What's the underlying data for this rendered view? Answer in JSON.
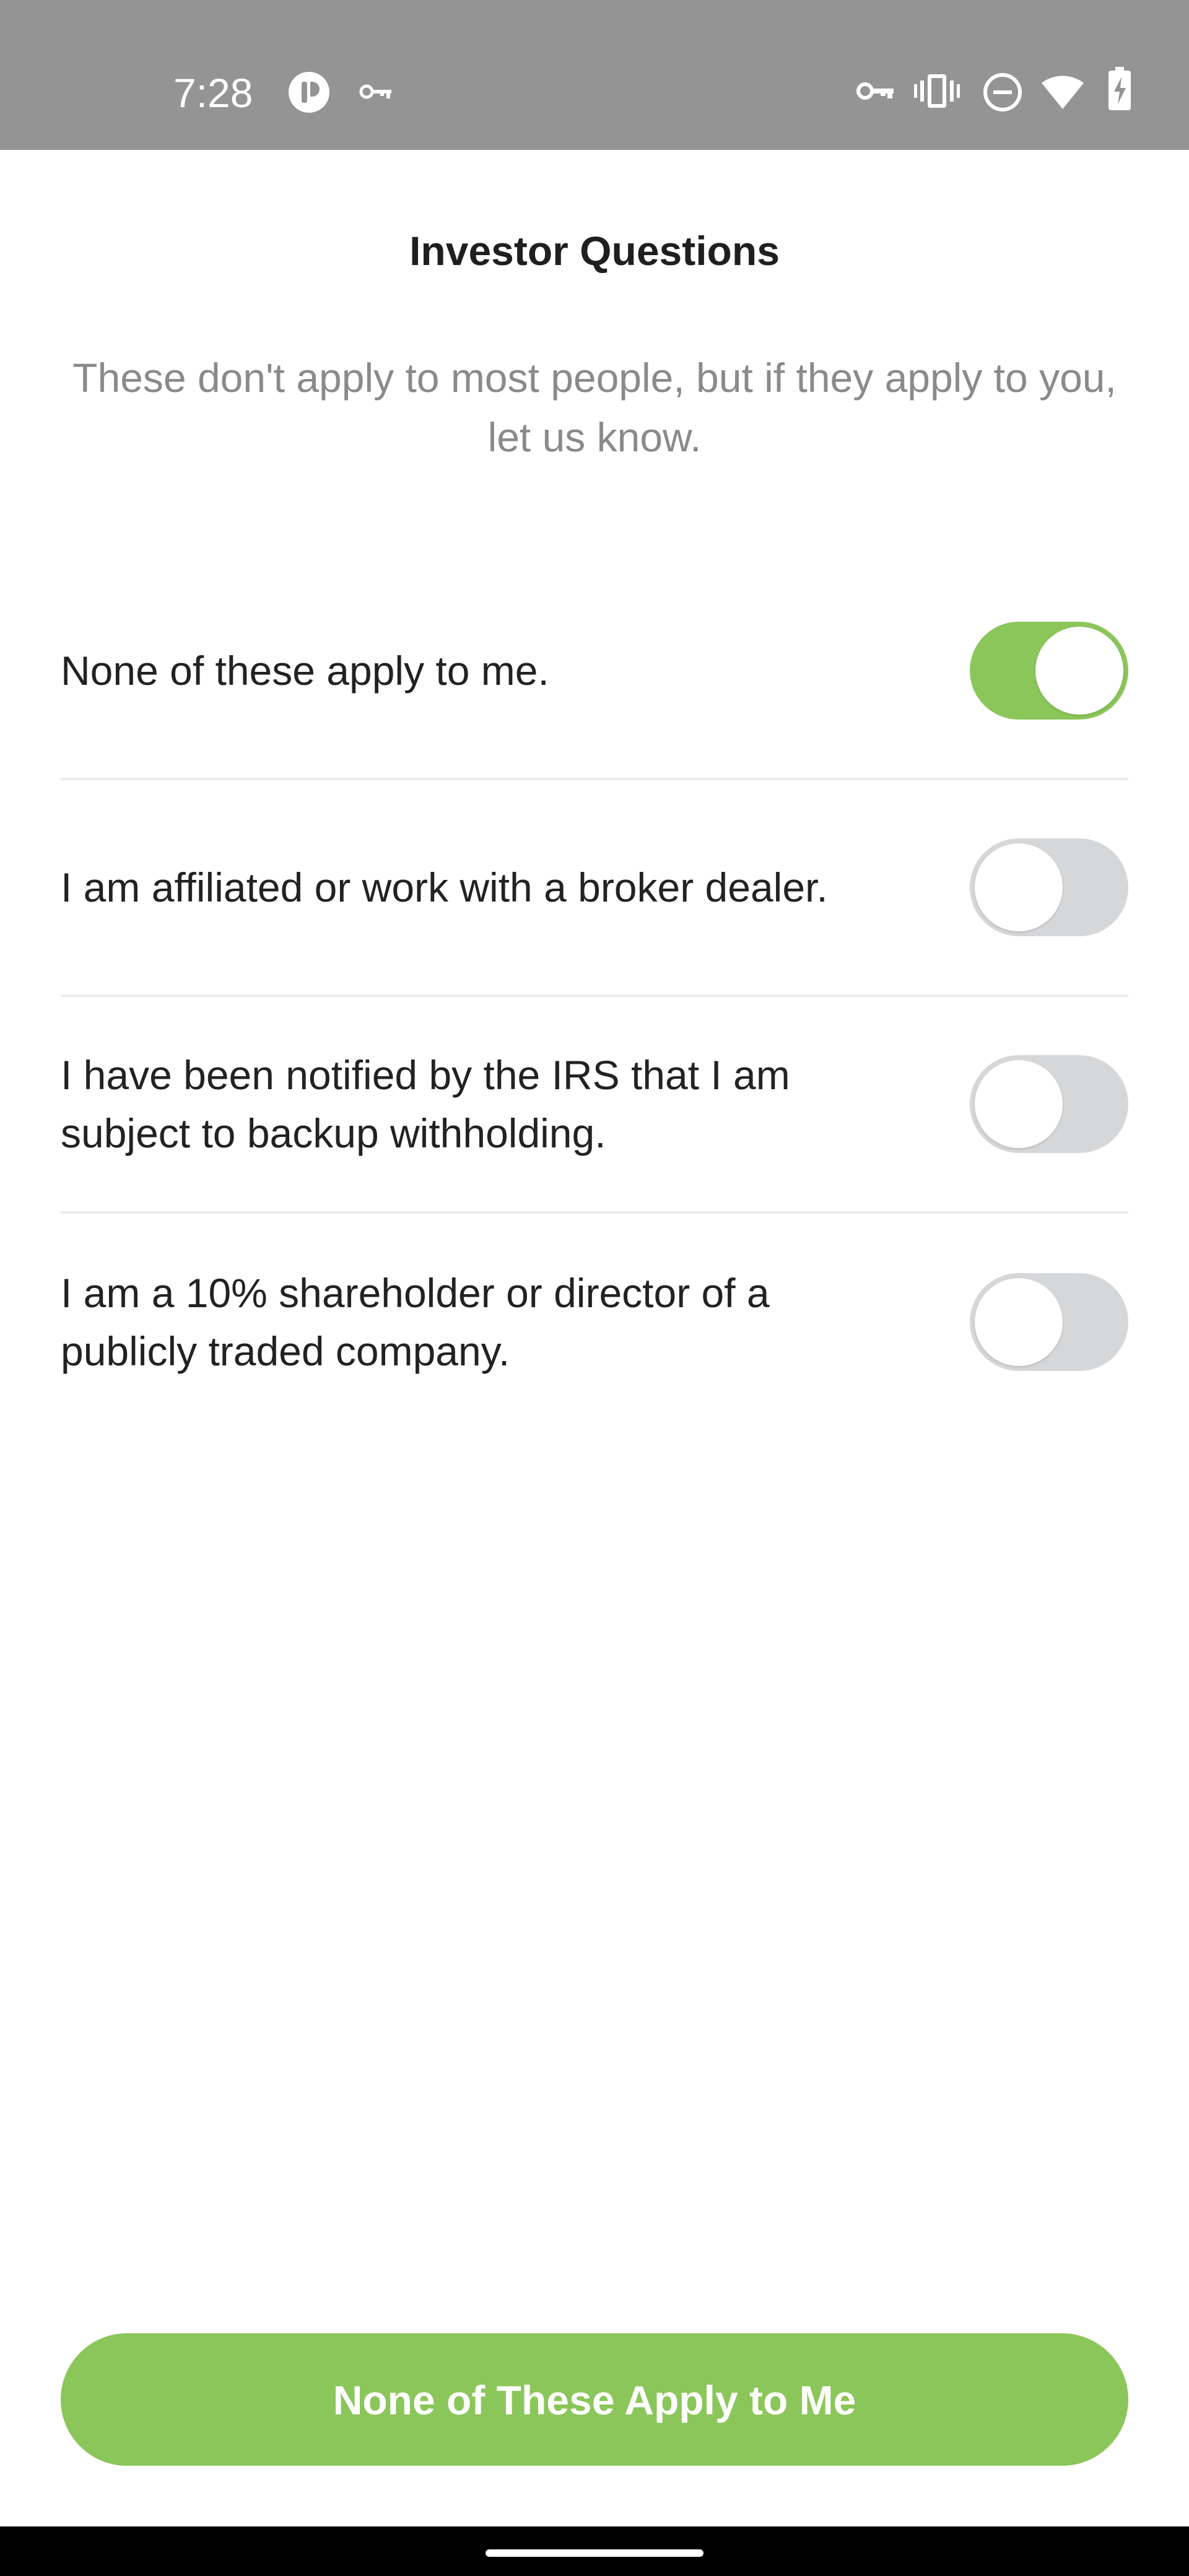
{
  "status_bar": {
    "time": "7:28",
    "left_icons": [
      "app-notification-icon",
      "vpn-key-icon"
    ],
    "right_icons": [
      "vpn-key-icon",
      "vibrate-icon",
      "do-not-disturb-icon",
      "wifi-icon",
      "battery-charging-icon"
    ]
  },
  "header": {
    "title": "Investor Questions",
    "subtitle": "These don't apply to most people, but if they apply to you, let us know."
  },
  "questions": [
    {
      "label": "None of these apply to me.",
      "enabled": true
    },
    {
      "label": "I am affiliated or work with a broker dealer.",
      "enabled": false
    },
    {
      "label": "I have been notified by the IRS that I am subject to backup withholding.",
      "enabled": false
    },
    {
      "label": "I am a 10% shareholder or director of a publicly traded company.",
      "enabled": false
    }
  ],
  "primary_action": {
    "label": "None of These Apply to Me"
  },
  "colors": {
    "accent": "#8bc65a",
    "toggle_off": "#d6d7d9",
    "status_bar": "#949494",
    "subtitle_text": "#8a8a8a"
  }
}
